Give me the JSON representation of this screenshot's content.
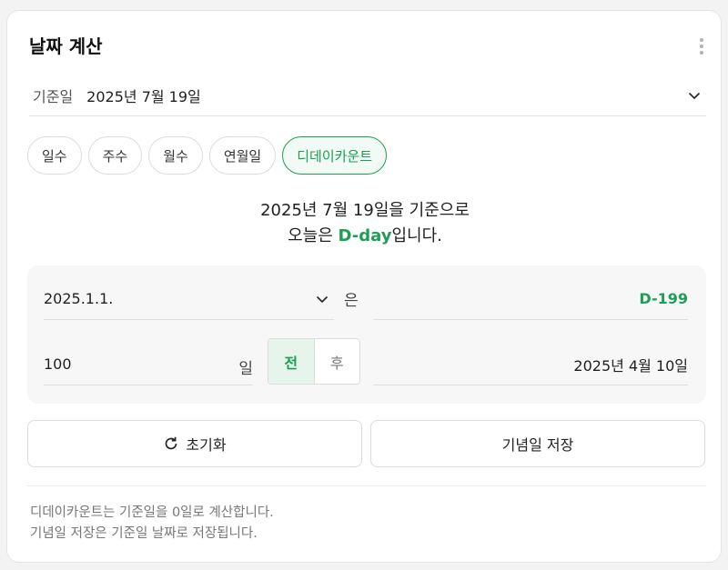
{
  "header": {
    "title": "날짜 계산"
  },
  "base_date": {
    "label": "기준일",
    "value": "2025년 7월 19일"
  },
  "tabs": [
    {
      "label": "일수",
      "active": false
    },
    {
      "label": "주수",
      "active": false
    },
    {
      "label": "월수",
      "active": false
    },
    {
      "label": "연월일",
      "active": false
    },
    {
      "label": "디데이카운트",
      "active": true
    }
  ],
  "summary": {
    "line1": "2025년 7월 19일을 기준으로",
    "line2_prefix": "오늘은 ",
    "line2_highlight": "D-day",
    "line2_suffix": "입니다."
  },
  "calc": {
    "date_value": "2025.1.1.",
    "particle": "은",
    "dday_result": "D-199",
    "days_value": "100",
    "days_unit": "일",
    "before_label": "전",
    "after_label": "후",
    "result_date": "2025년 4월 10일"
  },
  "buttons": {
    "reset": "초기화",
    "save": "기념일 저장"
  },
  "notes": {
    "line1": "디데이카운트는 기준일을 0일로 계산합니다.",
    "line2": "기념일 저장은 기준일 날짜로 저장됩니다."
  },
  "colors": {
    "accent": "#1d9e54",
    "accent_bg": "#e6f4ec"
  }
}
